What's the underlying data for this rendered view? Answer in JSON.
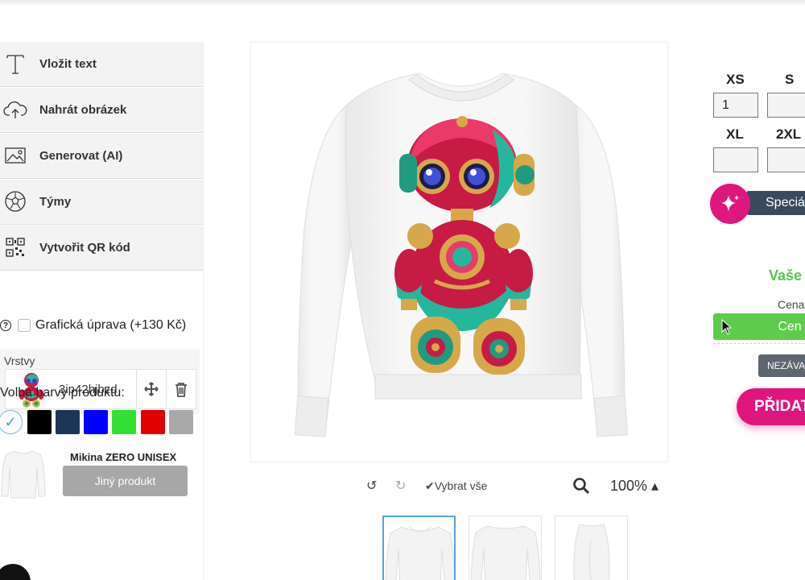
{
  "tools": [
    {
      "label": "Vložit text",
      "icon": "text-icon"
    },
    {
      "label": "Nahrát obrázek",
      "icon": "cloud-upload-icon"
    },
    {
      "label": "Generovat (AI)",
      "icon": "image-icon"
    },
    {
      "label": "Týmy",
      "icon": "soccer-ball-icon"
    },
    {
      "label": "Vytvořit QR kód",
      "icon": "qr-code-icon"
    }
  ],
  "graphic_edit": {
    "label": "Grafická úprava (+130 Kč)",
    "help": "?",
    "checked": false
  },
  "layers": {
    "title": "Vrstvy",
    "items": [
      {
        "name": "3ip42hjbzd"
      }
    ]
  },
  "colors": {
    "title": "Volba barvy produktu:",
    "swatches": [
      "#ffffff",
      "#000000",
      "#1d3557",
      "#0000ff",
      "#33e133",
      "#e00000",
      "#a9a9a9"
    ],
    "selected": "#ffffff"
  },
  "product": {
    "name": "Mikina ZERO UNISEX",
    "other_button": "Jiný produkt"
  },
  "canvas_toolbar": {
    "undo": "↺",
    "redo": "↻",
    "select_all": "✔Vybrat vše",
    "zoom": "100% ▴"
  },
  "sizes": [
    {
      "label": "XS",
      "value": "1"
    },
    {
      "label": "S",
      "value": ""
    },
    {
      "label": "XL",
      "value": ""
    },
    {
      "label": "2XL",
      "value": ""
    }
  ],
  "right": {
    "special": "Speciá",
    "your_price_heading": "Vaše",
    "price_label": "Cena",
    "price_button": "Cen",
    "nezav": "NEZÁVA",
    "add_button": "PŘIDAT"
  },
  "accent_colors": {
    "pink": "#e0167f",
    "green": "#5fcb4c",
    "dark": "#3a4a5c"
  }
}
